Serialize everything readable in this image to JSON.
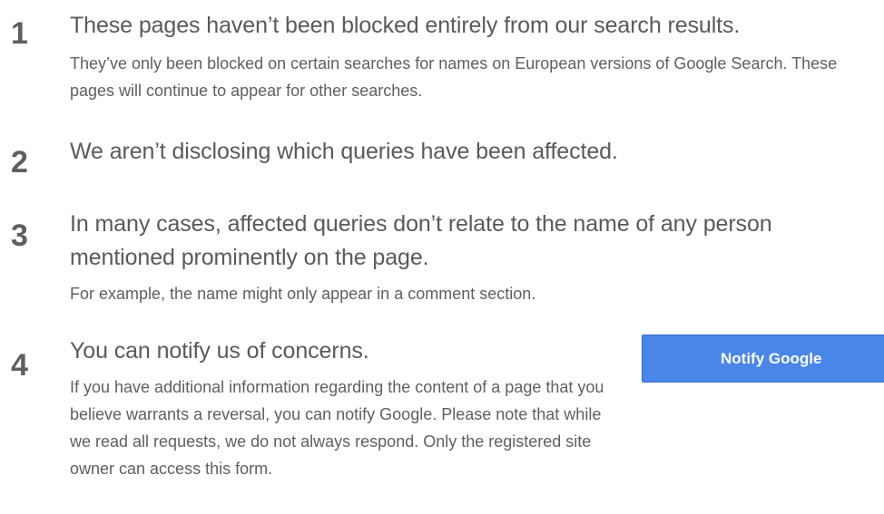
{
  "items": [
    {
      "number": "1",
      "title": "These pages haven’t been blocked entirely from our search results.",
      "description": "They’ve only been blocked on certain searches for names on European versions of Google Search. These pages will continue to appear for other searches."
    },
    {
      "number": "2",
      "title": "We aren’t disclosing which queries have been affected.",
      "description": ""
    },
    {
      "number": "3",
      "title": "In many cases, affected queries don’t relate to the name of any person mentioned prominently on the page.",
      "description": "For example, the name might only appear in a comment section."
    },
    {
      "number": "4",
      "title": "You can notify us of concerns.",
      "description": "If you have additional information regarding the content of a page that you believe warrants a reversal, you can notify Google. Please note that while we read all requests, we do not always respond. Only the registered site owner can access this form."
    }
  ],
  "notify_button": {
    "label": "Notify Google"
  },
  "colors": {
    "button": "#4a86e8",
    "text": "#555555"
  }
}
